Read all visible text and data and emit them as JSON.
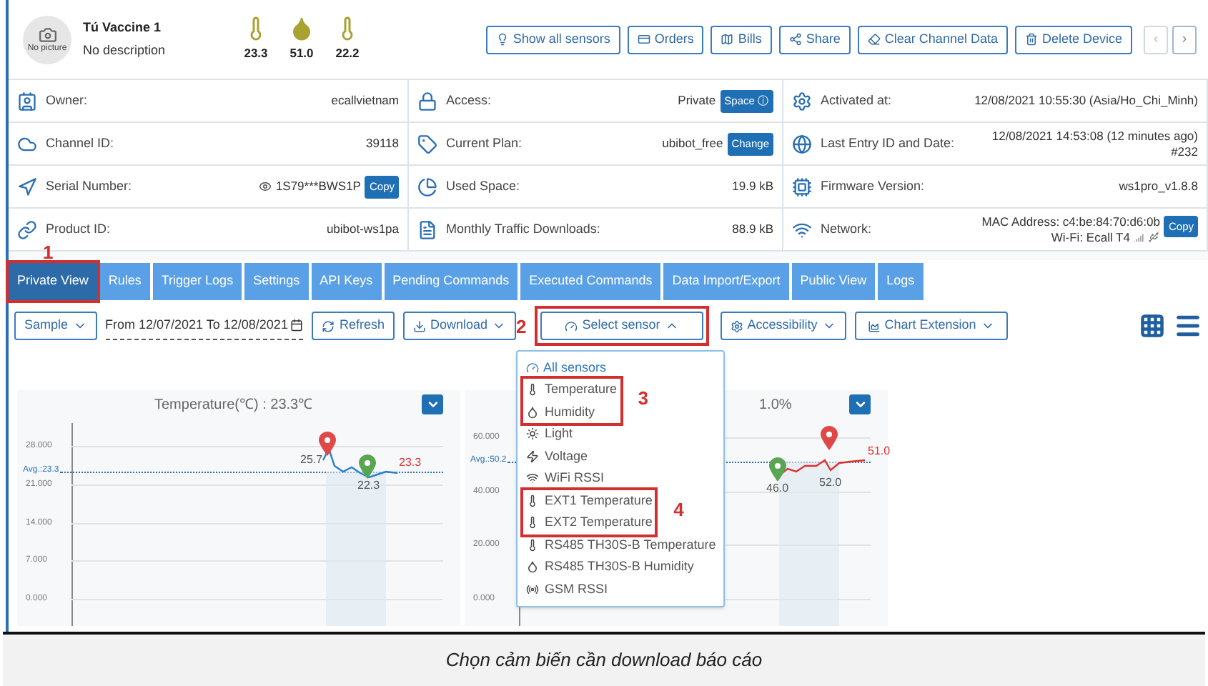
{
  "device": {
    "name": "Tú Vaccine 1",
    "description": "No description",
    "avatar_text": "No picture"
  },
  "readings": [
    {
      "value": "23.3"
    },
    {
      "value": "51.0"
    },
    {
      "value": "22.2"
    }
  ],
  "header_buttons": [
    {
      "label": "Show all sensors"
    },
    {
      "label": "Orders"
    },
    {
      "label": "Bills"
    },
    {
      "label": "Share"
    },
    {
      "label": "Clear Channel Data"
    },
    {
      "label": "Delete Device"
    }
  ],
  "pager": [
    {
      "label": "‹",
      "disabled": true
    },
    {
      "label": "›",
      "disabled": false
    }
  ],
  "info_rows": [
    [
      {
        "label": "Owner:",
        "lines": [
          "ecallvietnam"
        ]
      },
      {
        "label": "Access:",
        "lines": [
          "Private"
        ],
        "badge": "Space ⓘ"
      },
      {
        "label": "Activated at:",
        "lines": [
          "12/08/2021 10:55:30 (Asia/Ho_Chi_Minh)"
        ]
      }
    ],
    [
      {
        "label": "Channel ID:",
        "lines": [
          "39118"
        ]
      },
      {
        "label": "Current Plan:",
        "lines": [
          "ubibot_free"
        ],
        "badge": "Change"
      },
      {
        "label": "Last Entry ID and Date:",
        "lines": [
          "12/08/2021 14:53:08 (12 minutes ago)",
          "#232"
        ]
      }
    ],
    [
      {
        "label": "Serial Number:",
        "lines": [
          "1S79***BWS1P"
        ],
        "badge": "Copy",
        "masked": true
      },
      {
        "label": "Used Space:",
        "lines": [
          "19.9 kB"
        ]
      },
      {
        "label": "Firmware Version:",
        "lines": [
          "ws1pro_v1.8.8"
        ]
      }
    ],
    [
      {
        "label": "Product ID:",
        "lines": [
          "ubibot-ws1pa"
        ]
      },
      {
        "label": "Monthly Traffic Downloads:",
        "lines": [
          "88.9 kB"
        ]
      },
      {
        "label": "Network:",
        "lines": [
          "MAC Address: c4:be:84:70:d6:0b",
          "Wi-Fi: Ecall T4"
        ],
        "badge": "Copy"
      }
    ]
  ],
  "tabs": [
    {
      "label": "Private View",
      "selected": true,
      "highlighted": true,
      "marker": "1"
    },
    {
      "label": "Rules",
      "selected": false,
      "highlighted": false
    },
    {
      "label": "Trigger Logs",
      "selected": false,
      "highlighted": false
    },
    {
      "label": "Settings",
      "selected": false,
      "highlighted": false
    },
    {
      "label": "API Keys",
      "selected": false,
      "highlighted": false
    },
    {
      "label": "Pending Commands",
      "selected": false,
      "highlighted": false
    },
    {
      "label": "Executed Commands",
      "selected": false,
      "highlighted": false
    },
    {
      "label": "Data Import/Export",
      "selected": false,
      "highlighted": false
    },
    {
      "label": "Public View",
      "selected": false,
      "highlighted": false
    },
    {
      "label": "Logs",
      "selected": false,
      "highlighted": false
    }
  ],
  "toolbar": {
    "sample": "Sample",
    "date_range": "From 12/07/2021 To 12/08/2021",
    "refresh": "Refresh",
    "download": {
      "label": "Download",
      "marker": "2"
    },
    "select_sensor": {
      "label": "Select sensor",
      "expanded": true,
      "highlighted": true
    },
    "accessibility": "Accessibility",
    "chart_extension": "Chart Extension"
  },
  "sensor_menu": {
    "all": "All sensors",
    "groups": [
      {
        "highlighted": true,
        "marker": "3",
        "items": [
          "Temperature",
          "Humidity"
        ]
      },
      {
        "highlighted": false,
        "items": [
          "Light",
          "Voltage",
          "WiFi RSSI"
        ]
      },
      {
        "highlighted": true,
        "marker": "4",
        "items": [
          "EXT1 Temperature",
          "EXT2 Temperature"
        ]
      },
      {
        "highlighted": false,
        "items": [
          "RS485 TH30S-B Temperature",
          "RS485 TH30S-B Humidity",
          "GSM RSSI"
        ]
      }
    ]
  },
  "charts": [
    {
      "title": "Temperature(℃) : 23.3℃",
      "yticks": [
        "28.000",
        "21.000",
        "14.000",
        "7.000",
        "0.000"
      ],
      "avg_label": "Avg.:23.3",
      "max_label": "25.7",
      "min_label": "22.3",
      "last_label": "23.3"
    },
    {
      "title": "1.0%",
      "yticks": [
        "60.000",
        "40.000",
        "20.000",
        "0.000"
      ],
      "avg_label": "Avg.:50.2",
      "max_label": "52.0",
      "min_label": "46.0",
      "last_label": "51.0"
    }
  ],
  "caption": "Chọn cảm biến cần download báo cáo"
}
